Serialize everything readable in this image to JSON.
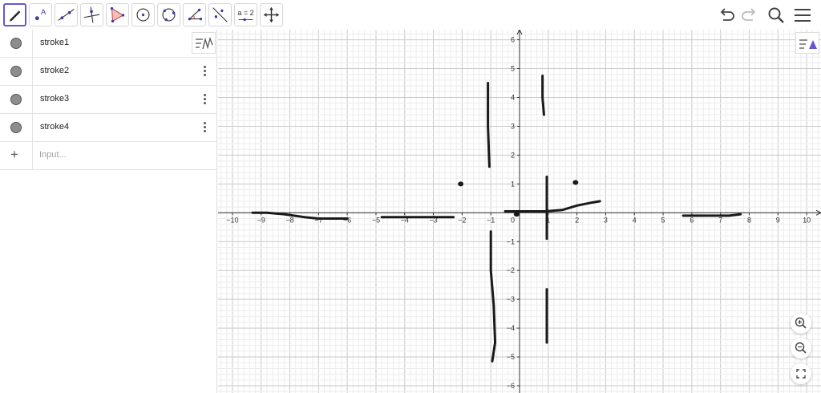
{
  "toolbar": {
    "tools": [
      {
        "name": "pen-tool",
        "active": true
      },
      {
        "name": "point-tool"
      },
      {
        "name": "line-tool"
      },
      {
        "name": "perpendicular-line-tool"
      },
      {
        "name": "polygon-tool"
      },
      {
        "name": "circle-center-tool"
      },
      {
        "name": "circle-three-points-tool"
      },
      {
        "name": "angle-tool"
      },
      {
        "name": "reflect-tool"
      },
      {
        "name": "slider-tool",
        "label": "a = 2"
      },
      {
        "name": "move-graphics-tool"
      }
    ],
    "right": [
      "undo-icon",
      "redo-icon",
      "search-icon",
      "menu-icon"
    ]
  },
  "algebra": {
    "items": [
      {
        "label": "stroke1",
        "color": "#8d8d8d"
      },
      {
        "label": "stroke2",
        "color": "#8d8d8d"
      },
      {
        "label": "stroke3",
        "color": "#8d8d8d"
      },
      {
        "label": "stroke4",
        "color": "#8d8d8d"
      }
    ],
    "input_placeholder": "Input..."
  },
  "graphics": {
    "x_range": [
      -10.5,
      10.5
    ],
    "y_range": [
      -6.25,
      6.35
    ],
    "x_ticks": [
      -10,
      -9,
      -8,
      -7,
      -6,
      -5,
      -4,
      -3,
      -2,
      -1,
      0,
      1,
      2,
      3,
      4,
      5,
      6,
      7,
      8,
      9,
      10
    ],
    "y_ticks": [
      -6,
      -5,
      -4,
      -3,
      -2,
      -1,
      1,
      2,
      3,
      4,
      5,
      6
    ],
    "origin_label": "0",
    "grid": true,
    "stroke_color": "#1a1a1a",
    "strokes": [
      [
        [
          -9.3,
          0.0
        ],
        [
          -8.8,
          0.0
        ],
        [
          -8.2,
          -0.05
        ],
        [
          -7.5,
          -0.15
        ],
        [
          -7.0,
          -0.2
        ],
        [
          -6.5,
          -0.2
        ],
        [
          -6.0,
          -0.2
        ]
      ],
      [
        [
          -4.8,
          -0.15
        ],
        [
          -4.0,
          -0.15
        ],
        [
          -3.2,
          -0.15
        ],
        [
          -2.3,
          -0.15
        ]
      ],
      [
        [
          -1.1,
          4.5
        ],
        [
          -1.1,
          3.0
        ],
        [
          -1.05,
          1.6
        ]
      ],
      [
        [
          0.8,
          4.75
        ],
        [
          0.8,
          4.0
        ],
        [
          0.85,
          3.4
        ]
      ],
      [
        [
          -1.0,
          -0.65
        ],
        [
          -1.0,
          -2.0
        ],
        [
          -0.9,
          -3.2
        ],
        [
          -0.85,
          -4.5
        ],
        [
          -0.95,
          -5.15
        ]
      ],
      [
        [
          0.95,
          1.25
        ],
        [
          0.95,
          0.2
        ],
        [
          0.95,
          -0.9
        ]
      ],
      [
        [
          0.95,
          -2.65
        ],
        [
          0.95,
          -3.5
        ],
        [
          0.95,
          -4.5
        ]
      ],
      [
        [
          -0.5,
          0.05
        ],
        [
          0.2,
          0.05
        ],
        [
          0.9,
          0.05
        ],
        [
          1.5,
          0.1
        ],
        [
          2.0,
          0.25
        ],
        [
          2.5,
          0.35
        ],
        [
          2.8,
          0.4
        ]
      ],
      [
        [
          5.7,
          -0.1
        ],
        [
          6.5,
          -0.1
        ],
        [
          7.3,
          -0.1
        ],
        [
          7.7,
          -0.05
        ]
      ]
    ],
    "dots": [
      [
        -2.05,
        1.0
      ],
      [
        -0.1,
        -0.05
      ],
      [
        1.95,
        1.05
      ]
    ]
  }
}
